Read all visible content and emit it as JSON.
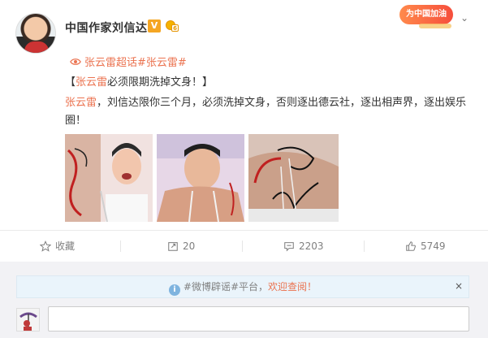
{
  "post": {
    "author": "中国作家刘信达",
    "verified_badge": "V",
    "fan_badge_number": "6",
    "promo_badge": "为中国加油",
    "topic": "张云雷超话#张云雷#",
    "title_open": "【",
    "title_name": "张云雷",
    "title_rest": "必须限期洗掉文身！】",
    "body_name": "张云雷",
    "body_rest": "，刘信达限你三个月，必须洗掉文身，否则逐出德云社，逐出相声界，逐出娱乐圈！",
    "photos": [
      "photo-1",
      "photo-2",
      "photo-3"
    ]
  },
  "actions": {
    "favorite_label": "收藏",
    "repost_count": "20",
    "comment_count": "2203",
    "like_count": "5749"
  },
  "comments": {
    "notice_prefix": "#微博辟谣#平台，",
    "notice_link": "欢迎查阅！",
    "close_label": "×",
    "reply_placeholder": ""
  },
  "icons": {
    "topic": "eye-icon",
    "favorite": "star-icon",
    "repost": "repost-icon",
    "comment": "comment-icon",
    "like": "thumbs-up-icon",
    "menu": "chevron-down-icon",
    "notice": "info-icon"
  },
  "colors": {
    "accent": "#eb7350",
    "text": "#333333",
    "muted": "#808080",
    "verified": "#f5a623"
  }
}
